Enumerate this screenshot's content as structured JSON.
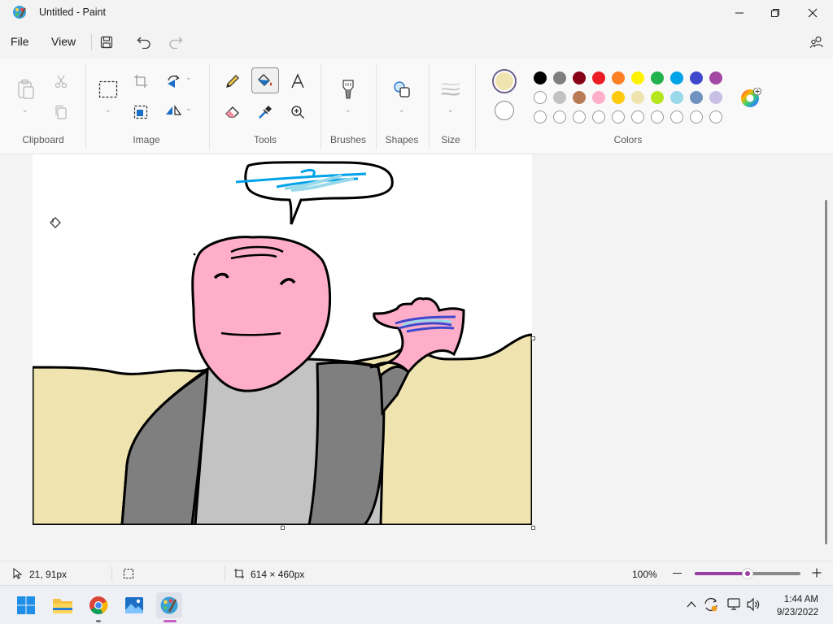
{
  "window": {
    "title": "Untitled - Paint"
  },
  "menu": {
    "file": "File",
    "view": "View"
  },
  "ribbon": {
    "groups": {
      "clipboard": "Clipboard",
      "image": "Image",
      "tools": "Tools",
      "brushes": "Brushes",
      "shapes": "Shapes",
      "size": "Size",
      "colors": "Colors"
    },
    "primary_color": "#efe4b0",
    "secondary_color": "#ffffff",
    "palette_row1": [
      "#000000",
      "#7f7f7f",
      "#880015",
      "#ed1c24",
      "#ff7f27",
      "#fff200",
      "#22b14c",
      "#00a2e8",
      "#3f48cc",
      "#a349a4"
    ],
    "palette_row2": [
      "#ffffff",
      "#c3c3c3",
      "#b97a57",
      "#ffaec9",
      "#ffc90e",
      "#efe4b0",
      "#b5e61d",
      "#99d9ea",
      "#7092be",
      "#c8bfe7"
    ],
    "palette_row3_empty_count": 10
  },
  "status": {
    "cursor_position": "21, 91px",
    "canvas_size": "614 × 460px",
    "zoom": "100%",
    "zoom_level": 0.5
  },
  "taskbar": {
    "time": "1:44 AM",
    "date": "9/23/2022",
    "icons": [
      "start-icon",
      "file-explorer-icon",
      "chrome-icon",
      "photos-icon",
      "paint-icon"
    ]
  }
}
